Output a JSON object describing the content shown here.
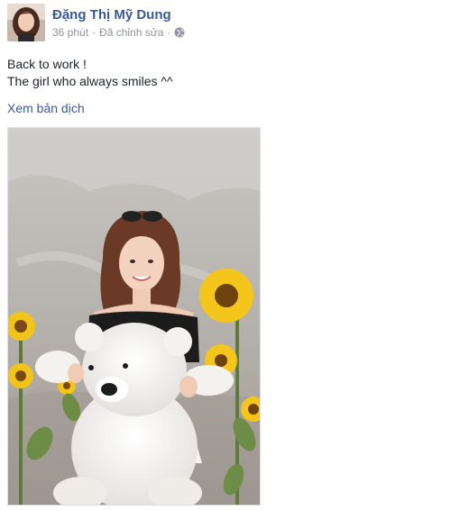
{
  "post": {
    "author_name": "Đặng Thị Mỹ Dung",
    "timestamp": "36 phút",
    "separator": "·",
    "edited_label": "Đã chỉnh sửa",
    "separator2": "·",
    "privacy_icon": "globe-icon",
    "text_lines": [
      "Back to work !",
      "The girl who always smiles ^^"
    ],
    "translate_link": "Xem bản dịch"
  },
  "colors": {
    "link_blue": "#3b5998",
    "meta_gray": "#90949c",
    "text_dark": "#1d2129"
  }
}
